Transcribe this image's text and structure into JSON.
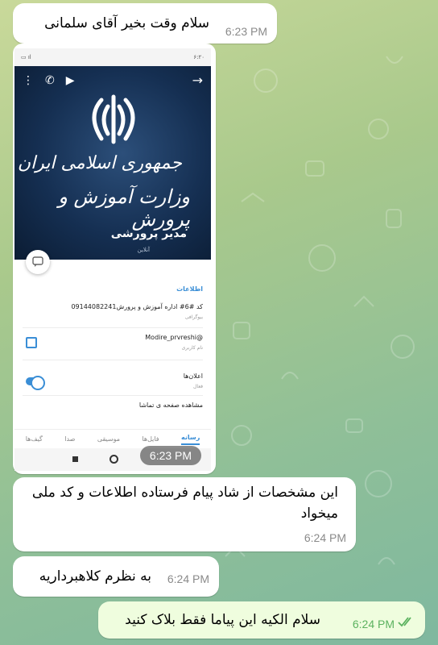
{
  "messages": [
    {
      "text": "سلام وقت بخیر آقای سلمانی",
      "time": "6:23 PM"
    },
    {
      "image_time": "6:23 PM"
    },
    {
      "text": "این مشخصات از شاد پیام فرستاده اطلاعات و کد ملی میخواد",
      "time": "6:24 PM"
    },
    {
      "text": "به نظرم کلاهبرداریه",
      "time": "6:24 PM"
    },
    {
      "text": "سلام الکیه این پیاما فقط بلاک کنید",
      "time": "6:24 PM"
    }
  ],
  "screenshot": {
    "status_time": "۶:۲۰",
    "header_line1": "جمهوری اسلامی ایران",
    "header_line2": "وزارت آموزش و پرورش",
    "profile_name": "مدیر پرورشی",
    "profile_status": "آنلاین",
    "info_title": "اطلاعات",
    "bio_value": "کد #6# اداره آموزش و پرورش09144082241",
    "bio_label": "بیوگرافی",
    "username_value": "@Modire_prvreshi",
    "username_label": "نام کاربری",
    "notif_label": "اعلان‌ها",
    "notif_status": "فعال",
    "view_page": "مشاهده صفحه ی تماشا",
    "tabs": [
      "رسانه",
      "فایل‌ها",
      "موسیقی",
      "صدا",
      "گیف‌ها"
    ]
  },
  "colors": {
    "accent": "#3a8ed6",
    "outgoing": "#effdde",
    "read_check": "#5bb25f"
  }
}
